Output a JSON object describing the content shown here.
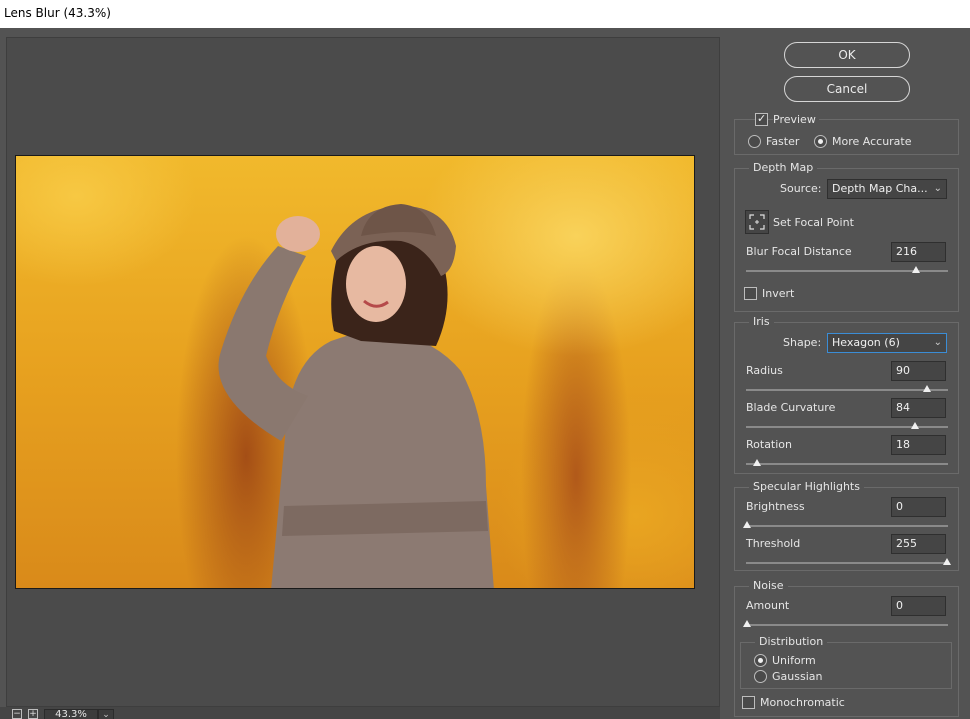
{
  "window": {
    "title": "Lens Blur (43.3%)"
  },
  "zoom": {
    "value": "43.3%",
    "minus_label": "−",
    "plus_label": "+",
    "dropdown_caret": "⌄"
  },
  "buttons": {
    "ok": "OK",
    "cancel": "Cancel"
  },
  "preview": {
    "label": "Preview",
    "checked": true,
    "faster_label": "Faster",
    "more_accurate_label": "More Accurate",
    "selected": "More Accurate"
  },
  "depth_map": {
    "legend": "Depth Map",
    "source_label": "Source:",
    "source_value": "Depth Map Cha...",
    "set_focal_point_label": "Set Focal Point",
    "blur_focal_distance_label": "Blur Focal Distance",
    "blur_focal_distance_value": "216",
    "invert_label": "Invert",
    "invert_checked": false
  },
  "iris": {
    "legend": "Iris",
    "shape_label": "Shape:",
    "shape_value": "Hexagon (6)",
    "radius_label": "Radius",
    "radius_value": "90",
    "blade_curvature_label": "Blade Curvature",
    "blade_curvature_value": "84",
    "rotation_label": "Rotation",
    "rotation_value": "18"
  },
  "specular": {
    "legend": "Specular Highlights",
    "brightness_label": "Brightness",
    "brightness_value": "0",
    "threshold_label": "Threshold",
    "threshold_value": "255"
  },
  "noise": {
    "legend": "Noise",
    "amount_label": "Amount",
    "amount_value": "0",
    "distribution_legend": "Distribution",
    "uniform_label": "Uniform",
    "gaussian_label": "Gaussian",
    "selected": "Uniform",
    "monochromatic_label": "Monochromatic",
    "monochromatic_checked": false
  },
  "icons": {
    "dropdown": "chevron-down-icon",
    "focal": "focal-point-icon"
  }
}
